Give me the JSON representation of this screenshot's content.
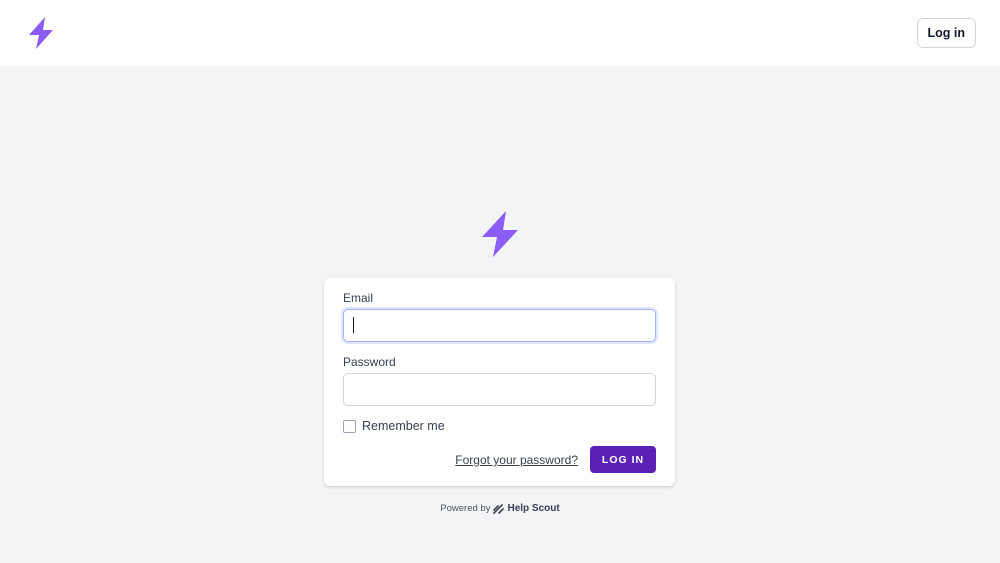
{
  "header": {
    "login_label": "Log in",
    "logo_icon": "lightning-bolt-icon",
    "brand_color": "#8b5cf6"
  },
  "form": {
    "email_label": "Email",
    "email_value": "",
    "password_label": "Password",
    "password_value": "",
    "remember_label": "Remember me",
    "remember_checked": false,
    "forgot_label": "Forgot your password?",
    "submit_label": "LOG IN",
    "submit_color": "#5b21b6"
  },
  "footer": {
    "powered_prefix": "Powered by",
    "powered_brand": "Help Scout",
    "brand_icon": "help-scout-logo-icon"
  }
}
